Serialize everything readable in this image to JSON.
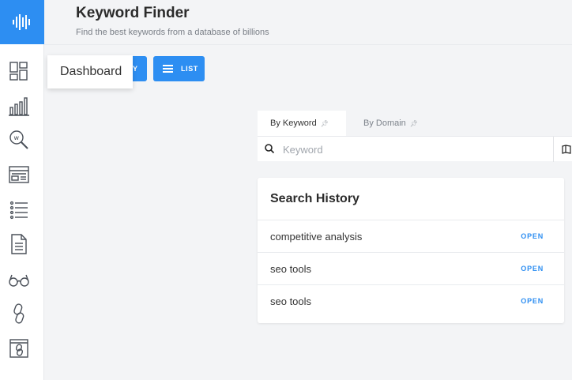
{
  "header": {
    "title": "Keyword Finder",
    "subtitle": "Find the best keywords from a database of billions"
  },
  "sidebar": {
    "logo_icon": "waveform-icon",
    "items": [
      {
        "icon": "dashboard-icon"
      },
      {
        "icon": "bar-chart-icon"
      },
      {
        "icon": "keyword-search-icon"
      },
      {
        "icon": "browser-window-icon"
      },
      {
        "icon": "list-icon"
      },
      {
        "icon": "document-icon"
      },
      {
        "icon": "glasses-icon"
      },
      {
        "icon": "link-icon"
      },
      {
        "icon": "web-link-icon"
      }
    ],
    "tooltip": "Dashboard"
  },
  "toolbar": {
    "query_label": "Y",
    "list_label": "LIST"
  },
  "search": {
    "tabs": [
      {
        "label": "By Keyword",
        "active": true
      },
      {
        "label": "By Domain",
        "active": false
      }
    ],
    "placeholder": "Keyword",
    "value": ""
  },
  "history": {
    "title": "Search History",
    "rows": [
      {
        "term": "competitive analysis",
        "action": "OPEN"
      },
      {
        "term": "seo tools",
        "action": "OPEN"
      },
      {
        "term": "seo tools",
        "action": "OPEN"
      }
    ]
  },
  "colors": {
    "accent": "#2d8ef2",
    "background": "#f3f4f6",
    "sidebar_icon": "#4a5059"
  }
}
